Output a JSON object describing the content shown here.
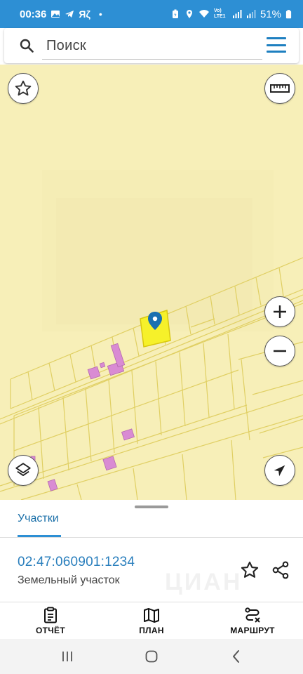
{
  "status_bar": {
    "time": "00:36",
    "app_indicator": "Яζ",
    "dot": "•",
    "network_label": "Vo) LTE1",
    "battery": "51%"
  },
  "search": {
    "placeholder": "Поиск",
    "search_icon": "search-icon",
    "menu_icon": "menu-icon"
  },
  "map": {
    "zoom_in_icon": "plus-icon",
    "zoom_out_icon": "minus-icon",
    "favorite_icon": "star-icon",
    "ruler_icon": "ruler-icon",
    "layers_icon": "layers-icon",
    "locate_icon": "navigation-arrow-icon",
    "marker_icon": "map-pin-icon",
    "colors": {
      "background": "#f7efb8",
      "parcel_border": "#e2d36a",
      "selected_parcel": "#f6f12a",
      "building": "#d98bd3",
      "marker": "#1a70b0"
    }
  },
  "sheet": {
    "tab_label": "Участки",
    "cadastral_number": "02:47:060901:1234",
    "parcel_type": "Земельный участок",
    "watermark": "ЦИАН"
  },
  "actions": [
    {
      "label": "ОТЧЁТ",
      "icon": "clipboard-icon"
    },
    {
      "label": "ПЛАН",
      "icon": "map-icon"
    },
    {
      "label": "МАРШРУТ",
      "icon": "route-icon"
    }
  ],
  "navbar": {
    "recents_icon": "recents-icon",
    "home_icon": "home-icon",
    "back_icon": "back-icon"
  },
  "colors": {
    "status_bar": "#2d8fd4",
    "accent": "#2a7fbd"
  }
}
